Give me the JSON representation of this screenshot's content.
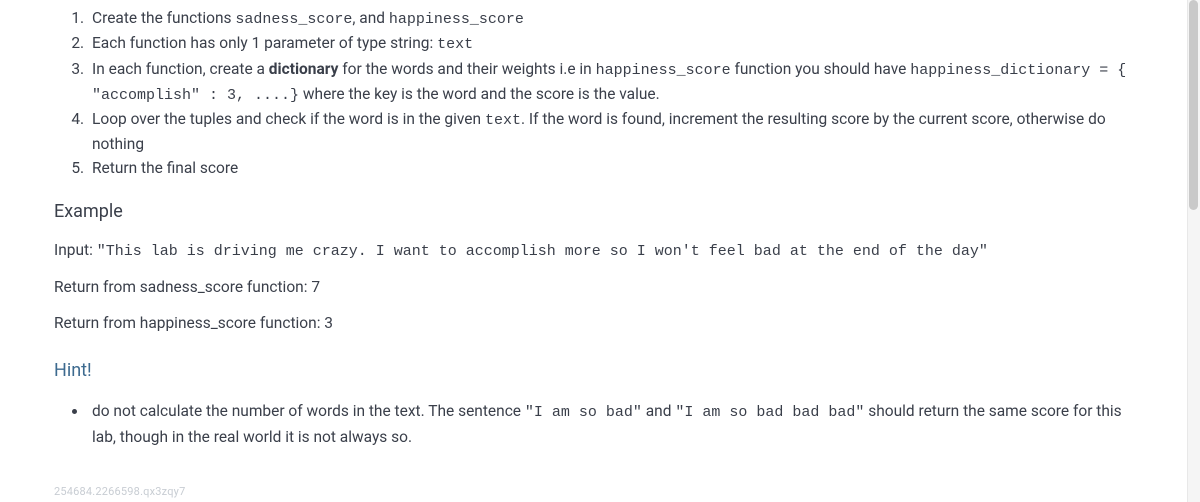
{
  "steps": {
    "s1_a": "Create the functions ",
    "s1_code1": "sadness_score",
    "s1_b": ", and ",
    "s1_code2": "happiness_score",
    "s2_a": "Each function has only 1 parameter of type string: ",
    "s2_code1": "text",
    "s3_a": "In each function, create a ",
    "s3_strong": "dictionary",
    "s3_b": " for the words and their weights i.e in ",
    "s3_code1": "happiness_score",
    "s3_c": " function you should have ",
    "s3_code2": "happiness_dictionary = { \"accomplish\" : 3, ....}",
    "s3_d": " where the key is the word and the score is the value.",
    "s4_a": "Loop over the tuples and check if the word is in the given ",
    "s4_code1": "text",
    "s4_b": ". If the word is found, increment the resulting score by the current score, otherwise do nothing",
    "s5_a": "Return the final score"
  },
  "example": {
    "heading": "Example",
    "input_label": "Input: ",
    "input_code": "\"This lab is driving me crazy. I want to accomplish more so I won't feel bad at the end of the day\"",
    "ret1": "Return from sadness_score function: 7",
    "ret2": "Return from happiness_score function: 3"
  },
  "hint": {
    "heading": "Hint!",
    "h1_a": "do not calculate the number of words in the text. The sentence ",
    "h1_code1": "\"I am so bad\"",
    "h1_b": " and ",
    "h1_code2": "\"I am so bad bad bad\"",
    "h1_c": " should return the same score for this lab, though in the real world it is not always so."
  },
  "footer": "254684.2266598.qx3zqy7"
}
